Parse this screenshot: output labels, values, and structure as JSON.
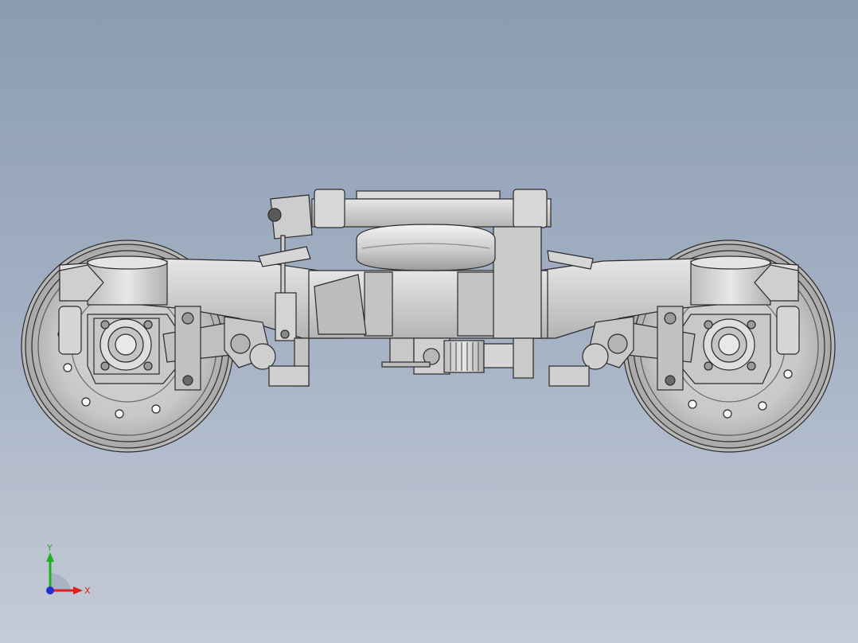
{
  "viewport": {
    "background_top": "#8a9bb2",
    "background_bottom": "#c5cbd6",
    "model_colors": {
      "body": "#d4d4d4",
      "shadow": "#9c9c9c",
      "edge": "#2a2a2a",
      "highlight": "#f2f2f2"
    }
  },
  "triad": {
    "x_label": "X",
    "y_label": "Y",
    "colors": {
      "x": "#e02020",
      "y": "#20b020",
      "z": "#2030d0"
    }
  }
}
